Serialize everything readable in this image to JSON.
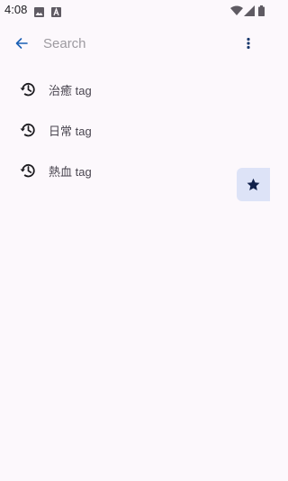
{
  "status_bar": {
    "time": "4:08",
    "icons": [
      "image-icon",
      "font-icon",
      "wifi-icon",
      "signal-icon",
      "battery-icon"
    ]
  },
  "search": {
    "placeholder": "Search",
    "value": ""
  },
  "history": {
    "items": [
      {
        "label": "治癒 tag"
      },
      {
        "label": "日常 tag"
      },
      {
        "label": "熱血 tag"
      }
    ]
  },
  "colors": {
    "background": "#fcf8fc",
    "accent": "#1a5fb4",
    "fab_background": "#dde3f7",
    "text_primary": "#1c1b1f",
    "text_secondary": "#49454f"
  }
}
